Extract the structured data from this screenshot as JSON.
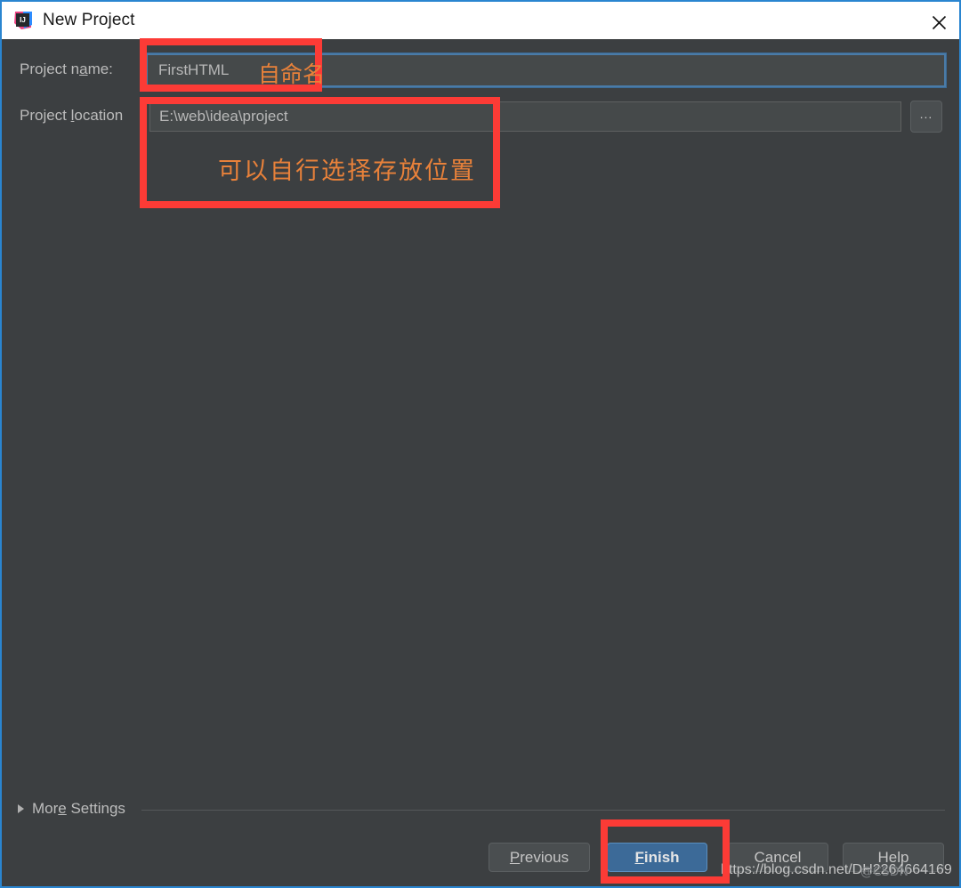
{
  "window": {
    "title": "New Project",
    "app_icon": "intellij-idea-icon",
    "close_icon": "close-icon",
    "accent_color": "#2a85d0",
    "background_color": "#3c3f41"
  },
  "form": {
    "name_label_pre": "Project n",
    "name_label_mnemonic": "a",
    "name_label_post": "me:",
    "name_value": "FirstHTML",
    "location_label_pre": "Project ",
    "location_label_mnemonic": "l",
    "location_label_post": "ocation",
    "location_value": "E:\\web\\idea\\project",
    "browse_label": "...",
    "browse_icon": "ellipsis-icon"
  },
  "more_settings": {
    "label_pre": "Mor",
    "label_mnemonic": "e",
    "label_post": " Settings",
    "expand_icon": "chevron-right-icon",
    "expanded": false
  },
  "buttons": {
    "previous": {
      "pre": "",
      "mnemonic": "P",
      "post": "revious"
    },
    "finish": {
      "pre": "",
      "mnemonic": "F",
      "post": "inish"
    },
    "cancel": {
      "pre": "Cancel",
      "mnemonic": "",
      "post": ""
    },
    "help": {
      "pre": "Help",
      "mnemonic": "",
      "post": ""
    }
  },
  "annotations": {
    "highlight_color": "#fc3b36",
    "note_color": "#e8813a",
    "note_name": "自命名",
    "note_location": "可以自行选择存放位置",
    "boxes": [
      "project-name-field",
      "project-location-field",
      "finish-button"
    ]
  },
  "watermark": {
    "url": "https://blog.csdn.net/DH2264664169",
    "mark": "@CSDN"
  }
}
